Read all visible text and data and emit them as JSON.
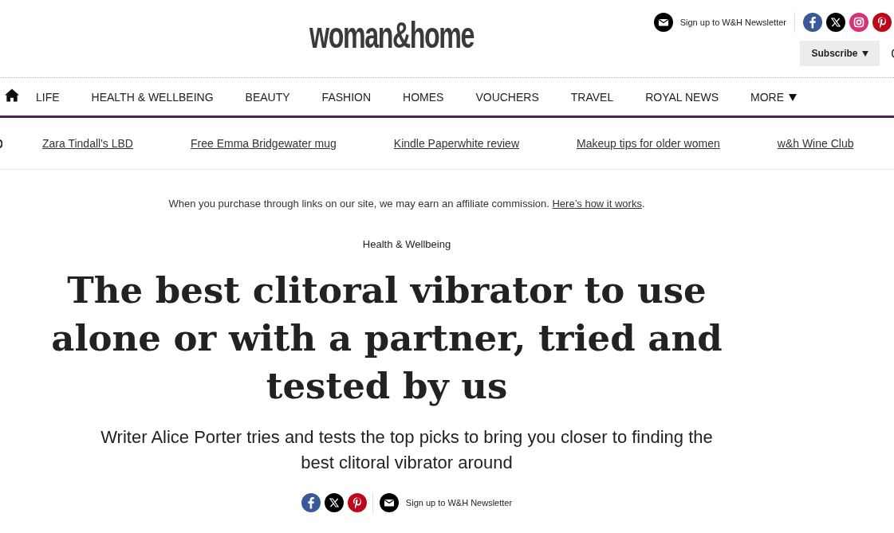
{
  "header": {
    "logo": "woman&home",
    "newsletter": "Sign up to W&H Newsletter",
    "social": [
      {
        "kind": "facebook"
      },
      {
        "kind": "x"
      },
      {
        "kind": "instagram"
      },
      {
        "kind": "pinterest"
      }
    ],
    "subscribe": "Subscribe"
  },
  "nav": {
    "items": [
      "LIFE",
      "HEALTH & WELLBEING",
      "BEAUTY",
      "FASHION",
      "HOMES",
      "VOUCHERS",
      "TRAVEL",
      "ROYAL NEWS"
    ],
    "more": "MORE"
  },
  "trending": [
    "Zara Tindall's LBD",
    "Free Emma Bridgewater mug",
    "Kindle Paperwhite review",
    "Makeup tips for older women",
    "w&h Wine Club"
  ],
  "article": {
    "disclosure": {
      "text": "When you purchase through links on our site, we may earn an affiliate commission.",
      "link": "Here’s how it works",
      "end": "."
    },
    "category": "Health & Wellbeing",
    "title": "The best clitoral vibrator to use alone or with a partner, tried and tested by us",
    "standfirst": "Writer Alice Porter tries and tests the top picks to bring you closer to finding the best clitoral vibrator around",
    "share": {
      "social": [
        {
          "kind": "facebook"
        },
        {
          "kind": "x"
        },
        {
          "kind": "pinterest"
        }
      ],
      "newsletter": "Sign up to W&H Newsletter"
    }
  }
}
